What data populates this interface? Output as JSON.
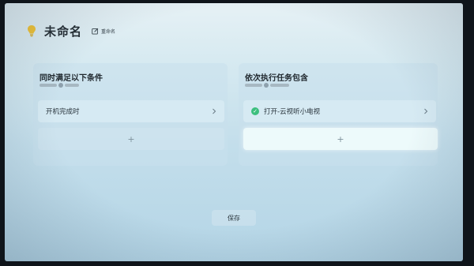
{
  "header": {
    "title": "未命名",
    "rename_label": "重命名"
  },
  "conditions": {
    "title": "同时满足以下条件",
    "items": [
      {
        "label": "开机完成时"
      }
    ],
    "add_symbol": "+"
  },
  "tasks": {
    "title": "依次执行任务包含",
    "items": [
      {
        "label": "打开-云视听小电视",
        "icon_text": "✓"
      }
    ],
    "add_symbol": "+"
  },
  "footer": {
    "save_label": "保存"
  },
  "colors": {
    "bulb": "#f2c230",
    "task_icon": "#3cbf7e",
    "focus": "#f0fcfc"
  }
}
